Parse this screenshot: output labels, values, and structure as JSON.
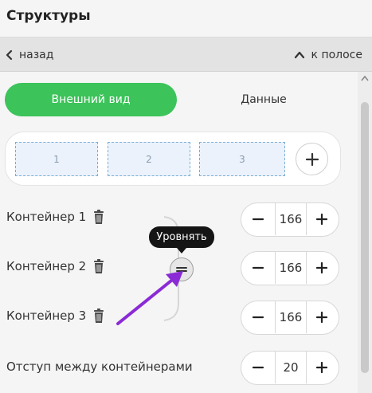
{
  "header": {
    "title": "Структуры"
  },
  "nav": {
    "back_label": "назад",
    "forward_label": "к полосе"
  },
  "tabs": [
    {
      "label": "Внешний вид",
      "active": true
    },
    {
      "label": "Данные",
      "active": false
    }
  ],
  "layout": {
    "slots": [
      "1",
      "2",
      "3"
    ]
  },
  "containers": [
    {
      "label": "Контейнер 1",
      "value": "166"
    },
    {
      "label": "Контейнер 2",
      "value": "166"
    },
    {
      "label": "Контейнер 3",
      "value": "166"
    }
  ],
  "spacing": {
    "label": "Отступ между контейнерами",
    "value": "20"
  },
  "tooltip": {
    "text": "Уровнять"
  },
  "colors": {
    "accent": "#3cc35a",
    "annotation_arrow": "#8a2bd6",
    "tooltip_bg": "#151515"
  }
}
